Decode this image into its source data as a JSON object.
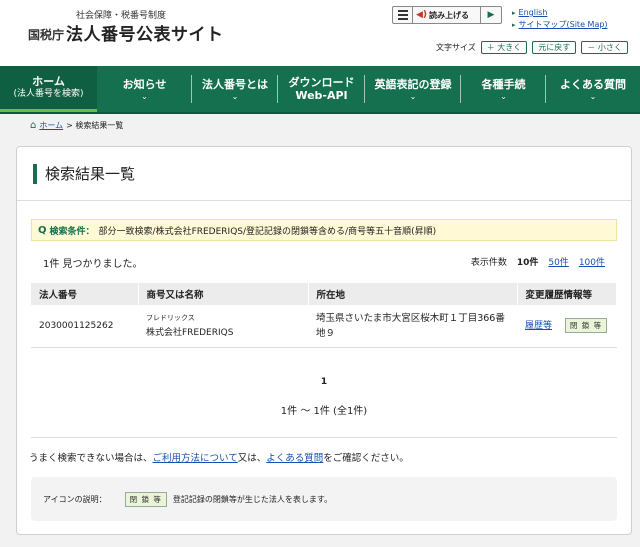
{
  "header": {
    "sub_title": "社会保障・税番号制度",
    "agency": "国税庁",
    "site_title": "法人番号公表サイト",
    "read_aloud": "読み上げる",
    "links": [
      "English",
      "サイトマップ(Site Map)"
    ],
    "font_size_label": "文字サイズ",
    "font_buttons": [
      "＋ 大きく",
      "元に戻す",
      "－ 小さく"
    ]
  },
  "nav": {
    "items": [
      {
        "line1": "ホーム",
        "line2": "(法人番号を検索)"
      },
      {
        "line1": "お知らせ",
        "line2": ""
      },
      {
        "line1": "法人番号とは",
        "line2": ""
      },
      {
        "line1": "ダウンロード",
        "line2": "Web-API"
      },
      {
        "line1": "英語表記の登録",
        "line2": ""
      },
      {
        "line1": "各種手続",
        "line2": ""
      },
      {
        "line1": "よくある質問",
        "line2": ""
      }
    ]
  },
  "breadcrumb": {
    "home": "ホーム",
    "current": "> 検索結果一覧"
  },
  "main": {
    "title": "検索結果一覧",
    "criteria_label": "検索条件：",
    "criteria_value": "部分一致検索/株式会社FREDERIQS/登記記録の閉鎖等含める/商号等五十音順(昇順)",
    "found_text": "1件 見つかりました。",
    "display_label": "表示件数",
    "display_options": [
      "10件",
      "50件",
      "100件"
    ]
  },
  "table": {
    "headers": [
      "法人番号",
      "商号又は名称",
      "所在地",
      "変更履歴情報等"
    ],
    "rows": [
      {
        "number": "2030001125262",
        "kana": "フレドリックス",
        "name": "株式会社FREDERIQS",
        "address": "埼玉県さいたま市大宮区桜木町１丁目366番地９",
        "history_link": "履歴等",
        "badge": "閉 鎖 等"
      }
    ]
  },
  "pager": {
    "page": "1",
    "range": "1件 ～ 1件 (全1件)"
  },
  "help": {
    "prefix": "うまく検索できない場合は、",
    "link1": "ご利用方法について",
    "mid": "又は、",
    "link2": "よくある質問",
    "suffix": "をご確認ください。"
  },
  "icon_legend": {
    "label": "アイコンの説明：",
    "badge": "閉 鎖 等",
    "desc": "登記記録の閉鎖等が生じた法人を表します。"
  },
  "colors": {
    "brand_green": "#14704f",
    "link": "#1a4fb0",
    "criteria_bg": "#fff9d6"
  }
}
